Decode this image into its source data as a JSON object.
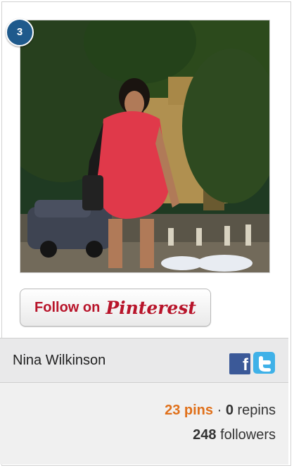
{
  "card": {
    "rank": "3",
    "photo": {
      "alt": "woman in red dress walking"
    },
    "follow_button": {
      "label": "Follow on",
      "brand": "Pinterest",
      "brand_color": "#b8142a"
    },
    "user": {
      "name": "Nina Wilkinson"
    },
    "social": {
      "facebook_icon": "facebook-icon",
      "twitter_icon": "twitter-icon",
      "facebook_color": "#3b5998",
      "twitter_color": "#3fb1e8"
    },
    "stats": {
      "pins_count": "23",
      "pins_label": "pins",
      "separator": "·",
      "repins_count": "0",
      "repins_label": "repins",
      "followers_count": "248",
      "followers_label": "followers",
      "accent_color": "#e0701a"
    }
  }
}
